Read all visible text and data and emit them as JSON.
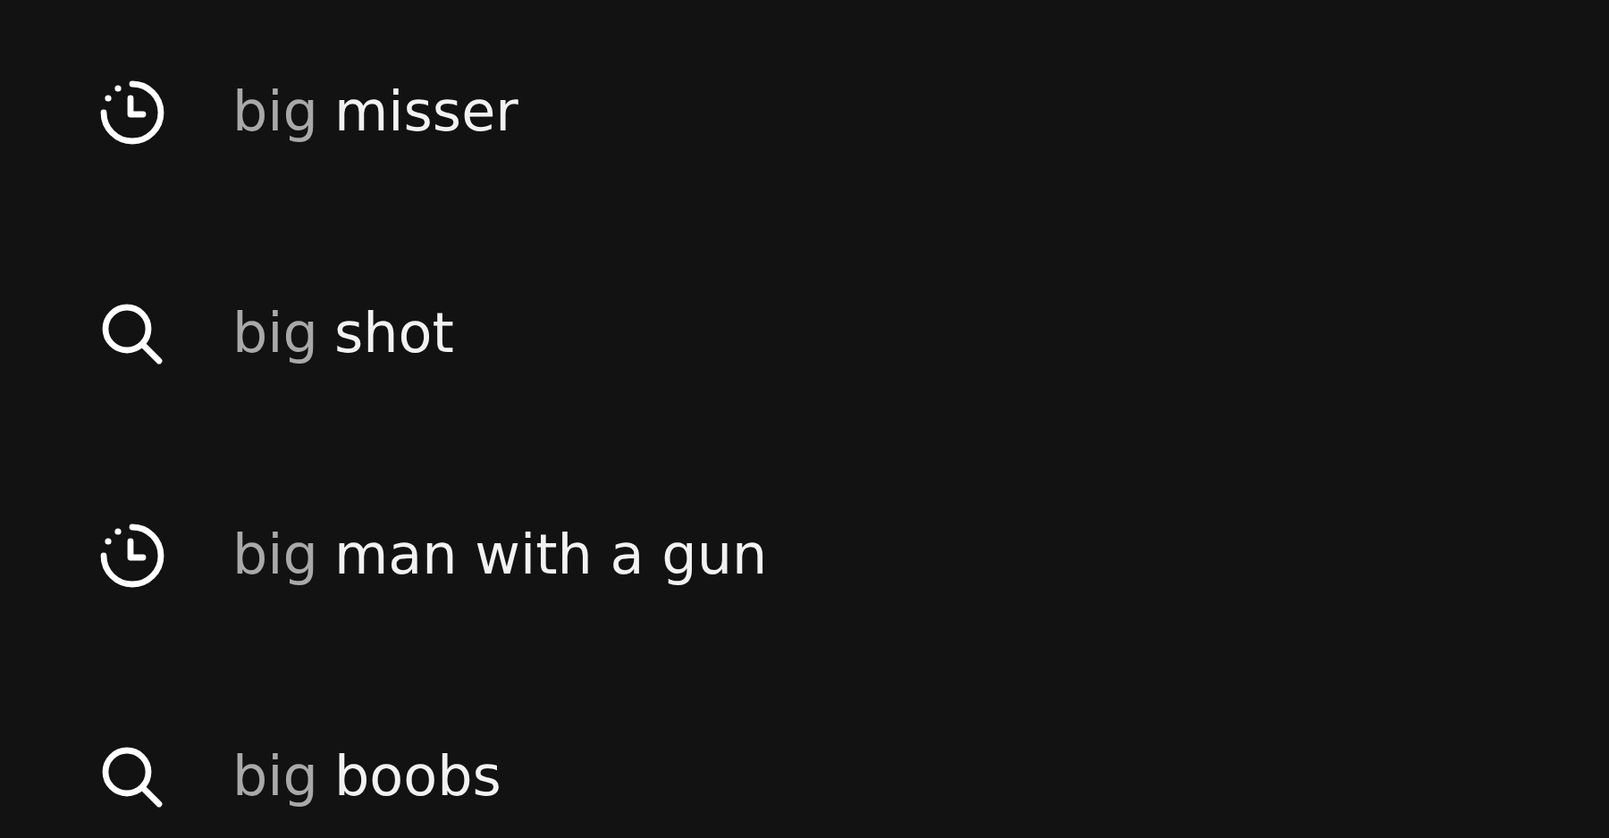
{
  "suggestions": [
    {
      "kind": "history",
      "query": "big",
      "completion": "misser"
    },
    {
      "kind": "search",
      "query": "big",
      "completion": "shot"
    },
    {
      "kind": "history",
      "query": "big",
      "completion": "man with a gun"
    },
    {
      "kind": "search",
      "query": "big",
      "completion": "boobs"
    }
  ]
}
